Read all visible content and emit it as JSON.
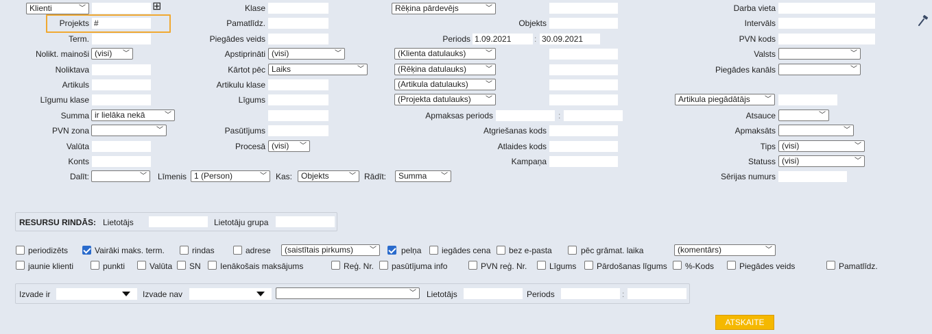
{
  "top": {
    "type_select": "Klienti",
    "plus": "⊞",
    "projekts_label": "Projekts",
    "projekts_value": "#",
    "term_label": "Term.",
    "nolikt_mainosi_label": "Nolikt. mainoši",
    "nolikt_mainosi_value": "(visi)",
    "noliktava_label": "Noliktava",
    "artikuls_label": "Artikuls",
    "ligumu_klase_label": "Līgumu klase",
    "summa_label": "Summa",
    "summa_value": "ir lielāka nekā",
    "pvn_zona_label": "PVN zona",
    "valuta_label": "Valūta",
    "konts_label": "Konts",
    "dalit_label": "Dalīt:",
    "limenis_label": "Līmenis",
    "limenis_value": "1 (Person)",
    "kas_label": "Kas:",
    "kas_value": "Objekts",
    "radit_label": "Rādīt:",
    "radit_value": "Summa"
  },
  "col2": {
    "klase": "Klase",
    "pamatlidz": "Pamatlīdz.",
    "piegades_veids": "Piegādes veids",
    "apstiprinati": "Apstiprināti",
    "apstiprinati_value": "(visi)",
    "kartot_pec": "Kārtot pēc",
    "kartot_pec_value": "Laiks",
    "artikulu_klase": "Artikulu klase",
    "ligums": "Līgums",
    "pasutijums": "Pasūtījums",
    "procesa": "Procesā",
    "procesa_value": "(visi)"
  },
  "col3": {
    "rekina_pardevejs": "Rēķina pārdevējs",
    "objekts": "Objekts",
    "periods_label": "Periods",
    "periods_from": "1.09.2021",
    "periods_sep": ":",
    "periods_to": "30.09.2021",
    "klienta_datulauks": "(Klienta datulauks)",
    "rekina_datulauks": "(Rēķina datulauks)",
    "artikula_datulauks": "(Artikula datulauks)",
    "projekta_datulauks": "(Projekta datulauks)",
    "apmaksas_periods": "Apmaksas periods",
    "apmaksas_sep": ":",
    "atgriesanas_kods": "Atgriešanas kods",
    "atlaides_kods": "Atlaides kods",
    "kampana": "Kampaņa"
  },
  "col4": {
    "darba_vieta": "Darba vieta",
    "intervals": "Intervāls",
    "pvn_kods": "PVN kods",
    "valsts": "Valsts",
    "piegades_kanals": "Piegādes kanāls",
    "artikula_piegadatajs": "Artikula piegādātājs",
    "atsauce": "Atsauce",
    "apmaksats": "Apmaksāts",
    "tips": "Tips",
    "tips_value": "(visi)",
    "statuss": "Statuss",
    "statuss_value": "(visi)",
    "serijas_numurs": "Sērijas numurs"
  },
  "resursu": {
    "title": "RESURSU RINDĀS:",
    "lietotajs": "Lietotājs",
    "lietotaju_grupa": "Lietotāju grupa"
  },
  "checks1": [
    {
      "label": "periodizēts",
      "checked": false
    },
    {
      "label": "Vairāki maks. term.",
      "checked": true
    },
    {
      "label": "rindas",
      "checked": false
    },
    {
      "label": "adrese",
      "checked": false
    },
    {
      "label": "pelņa",
      "checked": true
    },
    {
      "label": "iegādes cena",
      "checked": false
    },
    {
      "label": "bez e-pasta",
      "checked": false
    },
    {
      "label": "pēc grāmat. laika",
      "checked": false
    }
  ],
  "saistitais_pirkums": "(saistītais pirkums)",
  "komentars": "(komentārs)",
  "checks2": [
    {
      "label": "jaunie klienti",
      "checked": false
    },
    {
      "label": "punkti",
      "checked": false
    },
    {
      "label": "Valūta",
      "checked": false
    },
    {
      "label": "SN",
      "checked": false
    },
    {
      "label": "Ienākošais maksājums",
      "checked": false
    },
    {
      "label": "Reģ. Nr.",
      "checked": false
    },
    {
      "label": "pasūtījuma info",
      "checked": false
    },
    {
      "label": "PVN reģ. Nr.",
      "checked": false
    },
    {
      "label": "Līgums",
      "checked": false
    },
    {
      "label": "Pārdošanas līgums",
      "checked": false
    },
    {
      "label": "%-Kods",
      "checked": false
    },
    {
      "label": "Piegādes veids",
      "checked": false
    },
    {
      "label": "Pamatlīdz.",
      "checked": false
    }
  ],
  "izvade": {
    "izvade_ir": "Izvade ir",
    "izvade_nav": "Izvade nav",
    "lietotajs": "Lietotājs",
    "periods": "Periods",
    "sep": ":"
  },
  "atskaite_button": "ATSKAITE",
  "colors": {
    "background": "#e3e8f0",
    "highlight": "#f0a830",
    "button": "#f5b800",
    "checkbox_on": "#2a6bcc"
  },
  "icons": {
    "tool": "hammer-icon",
    "add": "plus-box-icon"
  }
}
